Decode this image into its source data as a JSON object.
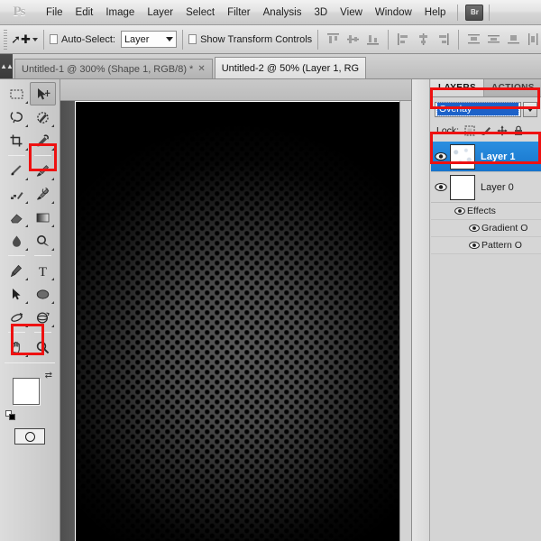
{
  "app": {
    "logo": "Ps",
    "bridge_button": "Br"
  },
  "menu": {
    "items": [
      {
        "label": "File"
      },
      {
        "label": "Edit"
      },
      {
        "label": "Image"
      },
      {
        "label": "Layer"
      },
      {
        "label": "Select"
      },
      {
        "label": "Filter"
      },
      {
        "label": "Analysis"
      },
      {
        "label": "3D"
      },
      {
        "label": "View"
      },
      {
        "label": "Window"
      },
      {
        "label": "Help"
      }
    ]
  },
  "options_bar": {
    "active_tool": "move-tool",
    "auto_select_label": "Auto-Select:",
    "auto_select_checked": false,
    "auto_select_target": "Layer",
    "show_transform_label": "Show Transform Controls",
    "show_transform_checked": false,
    "align_icons": [
      "align-top-edges",
      "align-vertical-centers",
      "align-bottom-edges",
      "align-left-edges",
      "align-horizontal-centers",
      "align-right-edges",
      "distribute-top-edges",
      "distribute-vertical-centers",
      "distribute-bottom-edges",
      "distribute-left-edges"
    ]
  },
  "tabs": [
    {
      "label": "Untitled-1 @ 300% (Shape 1, RGB/8) *",
      "active": false,
      "closeable": true
    },
    {
      "label": "Untitled-2 @ 50% (Layer 1, RG",
      "active": true,
      "closeable": false
    }
  ],
  "toolbar": {
    "tools": [
      {
        "name": "rectangular-marquee-tool",
        "selected": false
      },
      {
        "name": "move-tool",
        "selected": true
      },
      {
        "name": "lasso-tool",
        "selected": false
      },
      {
        "name": "quick-selection-tool",
        "selected": false
      },
      {
        "name": "crop-tool",
        "selected": false
      },
      {
        "name": "eyedropper-tool",
        "selected": false
      },
      {
        "name": "healing-brush-tool",
        "selected": false
      },
      {
        "name": "brush-tool",
        "selected": false,
        "highlighted": true
      },
      {
        "name": "clone-stamp-tool",
        "selected": false
      },
      {
        "name": "history-brush-tool",
        "selected": false
      },
      {
        "name": "eraser-tool",
        "selected": false
      },
      {
        "name": "gradient-tool",
        "selected": false
      },
      {
        "name": "blur-tool",
        "selected": false
      },
      {
        "name": "dodge-tool",
        "selected": false
      },
      {
        "name": "pen-tool",
        "selected": false
      },
      {
        "name": "horizontal-type-tool",
        "selected": false
      },
      {
        "name": "path-selection-tool",
        "selected": false
      },
      {
        "name": "ellipse-tool",
        "selected": false
      },
      {
        "name": "3d-rotate-tool",
        "selected": false
      },
      {
        "name": "3d-orbit-tool",
        "selected": false
      },
      {
        "name": "hand-tool",
        "selected": false
      },
      {
        "name": "zoom-tool",
        "selected": false
      }
    ],
    "foreground_color": "#ffffff",
    "background_color": "#000000",
    "foreground_highlighted": true,
    "quick_mask_mode": "edit-in-quick-mask-mode"
  },
  "canvas": {
    "document": "Untitled-2",
    "zoom": "50%",
    "pattern": "halftone-dot-pattern",
    "base_color": "#5a5a5a",
    "dot_color": "#050505",
    "dot_spacing_px": 11
  },
  "panels": {
    "tabs": [
      {
        "label": "LAYERS",
        "active": true
      },
      {
        "label": "ACTIONS",
        "active": false
      }
    ],
    "blend_mode": {
      "value": "Overlay",
      "highlighted": true
    },
    "lock": {
      "label": "Lock:",
      "icons": [
        "lock-transparent-pixels-icon",
        "lock-image-pixels-icon",
        "lock-position-icon",
        "lock-all-icon"
      ]
    },
    "layers": [
      {
        "name": "Layer 1",
        "visible": true,
        "selected": true,
        "highlighted": true,
        "thumbnail": "light-texture-thumb"
      },
      {
        "name": "Layer 0",
        "visible": true,
        "selected": false,
        "highlighted": false,
        "thumbnail": "white-thumb",
        "effects": {
          "label": "Effects",
          "visible": true,
          "items": [
            {
              "label": "Gradient O",
              "visible": true
            },
            {
              "label": "Pattern O",
              "visible": true
            }
          ]
        }
      }
    ]
  },
  "annotations": {
    "color": "#ee1111",
    "boxes": [
      {
        "name": "blend-mode-highlight",
        "target": "Overlay blend mode dropdown"
      },
      {
        "name": "layer1-highlight",
        "target": "Layer 1 row"
      },
      {
        "name": "brush-tool-highlight",
        "target": "Brush tool"
      },
      {
        "name": "foreground-swatch-highlight",
        "target": "Foreground color swatch"
      }
    ]
  }
}
